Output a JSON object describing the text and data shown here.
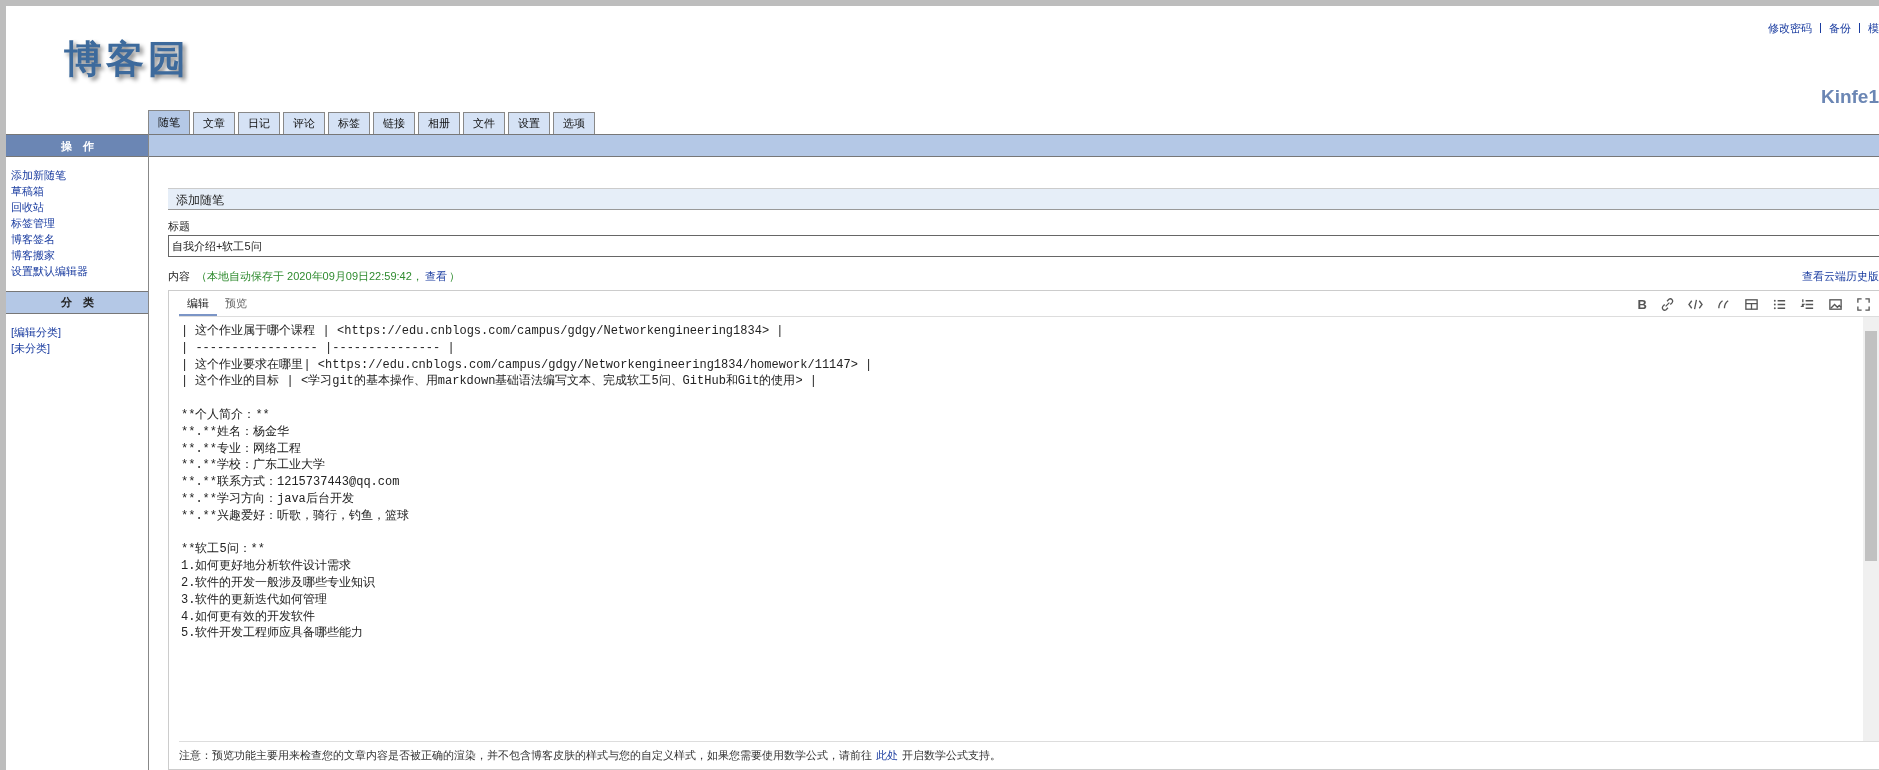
{
  "header": {
    "logo": "博客园",
    "top_links": [
      "修改密码",
      "备份",
      "模"
    ],
    "user_name": "Kinfe1"
  },
  "tabs": [
    {
      "label": "随笔",
      "selected": true
    },
    {
      "label": "文章",
      "selected": false
    },
    {
      "label": "日记",
      "selected": false
    },
    {
      "label": "评论",
      "selected": false
    },
    {
      "label": "标签",
      "selected": false
    },
    {
      "label": "链接",
      "selected": false
    },
    {
      "label": "相册",
      "selected": false
    },
    {
      "label": "文件",
      "selected": false
    },
    {
      "label": "设置",
      "selected": false
    },
    {
      "label": "选项",
      "selected": false
    }
  ],
  "sidebar": {
    "sections": [
      {
        "title": "操　作",
        "items": [
          "添加新随笔",
          "草稿箱",
          "回收站",
          "标签管理",
          "博客签名",
          "博客搬家",
          "设置默认编辑器"
        ]
      },
      {
        "title": "分　类",
        "items": [
          "[编辑分类]",
          "[未分类]"
        ]
      }
    ]
  },
  "form": {
    "section_title": "添加随笔",
    "title_label": "标题",
    "title_value": "自我介绍+软工5问",
    "content_label": "内容",
    "autosave_note": "（本地自动保存于 2020年09月09日22:59:42，",
    "autosave_link": "查看",
    "autosave_close": "）",
    "history_link": "查看云端历史版",
    "editor": {
      "tabs": [
        {
          "label": "编辑",
          "selected": true
        },
        {
          "label": "预览",
          "selected": false
        }
      ],
      "bold_label": "B",
      "blocks": [
        [
          "| 这个作业属于哪个课程 | <https://edu.cnblogs.com/campus/gdgy/Networkengineering1834> |",
          "| ----------------- |--------------- |",
          "| 这个作业要求在哪里| <https://edu.cnblogs.com/campus/gdgy/Networkengineering1834/homework/11147> |",
          "| 这个作业的目标 | <学习git的基本操作、用markdown基础语法编写文本、完成软工5问、GitHub和Git的使用> |"
        ],
        [
          "**个人简介：**",
          "**.**姓名：杨金华",
          "**.**专业：网络工程",
          "**.**学校：广东工业大学",
          "**.**联系方式：1215737443@qq.com",
          "**.**学习方向：java后台开发",
          "**.**兴趣爱好：听歌，骑行，钓鱼，篮球"
        ],
        [
          "**软工5问：**",
          "1.如何更好地分析软件设计需求",
          "2.软件的开发一般涉及哪些专业知识",
          "3.软件的更新迭代如何管理",
          "4.如何更有效的开发软件",
          "5.软件开发工程师应具备哪些能力"
        ]
      ],
      "note": "注意：预览功能主要用来检查您的文章内容是否被正确的渲染，并不包含博客皮肤的样式与您的自定义样式，如果您需要使用数学公式，请前往",
      "note_link": "此处",
      "note_end": "开启数学公式支持。"
    }
  }
}
